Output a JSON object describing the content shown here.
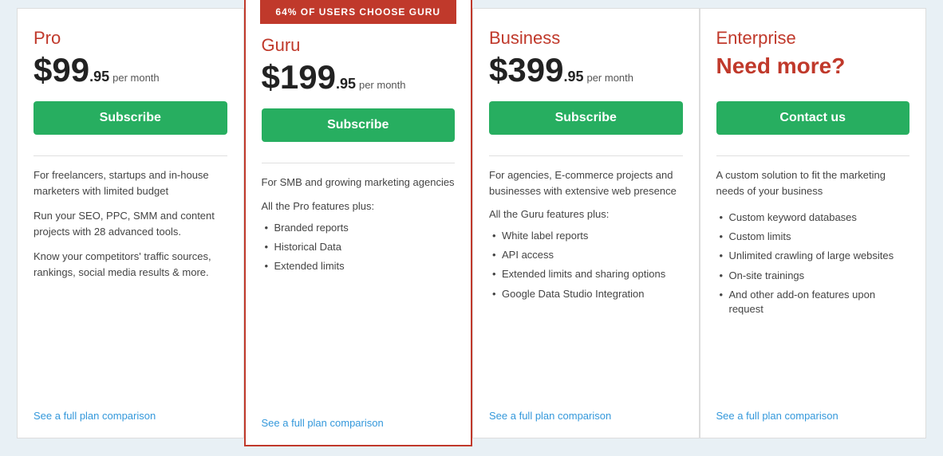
{
  "plans": [
    {
      "id": "pro",
      "name": "Pro",
      "price_main": "$99",
      "price_cents": ".95",
      "price_period": "per month",
      "button_label": "Subscribe",
      "description1": "For freelancers, startups and in-house marketers with limited budget",
      "description2": "Run your SEO, PPC, SMM and content projects with 28 advanced tools.",
      "description3": "Know your competitors' traffic sources, rankings, social media results & more.",
      "see_full_label": "See a full plan comparison",
      "featured": false,
      "featured_badge": ""
    },
    {
      "id": "guru",
      "name": "Guru",
      "price_main": "$199",
      "price_cents": ".95",
      "price_period": "per month",
      "button_label": "Subscribe",
      "description1": "For SMB and growing marketing agencies",
      "features_intro": "All the Pro features plus:",
      "features": [
        "Branded reports",
        "Historical Data",
        "Extended limits"
      ],
      "see_full_label": "See a full plan comparison",
      "featured": true,
      "featured_badge": "64% OF USERS CHOOSE GURU"
    },
    {
      "id": "business",
      "name": "Business",
      "price_main": "$399",
      "price_cents": ".95",
      "price_period": "per month",
      "button_label": "Subscribe",
      "description1": "For agencies, E-commerce projects and businesses with extensive web presence",
      "features_intro": "All the Guru features plus:",
      "features": [
        "White label reports",
        "API access",
        "Extended limits and sharing options",
        "Google Data Studio Integration"
      ],
      "see_full_label": "See a full plan comparison",
      "featured": false,
      "featured_badge": ""
    },
    {
      "id": "enterprise",
      "name": "Enterprise",
      "need_more": "Need more?",
      "button_label": "Contact us",
      "description1": "A custom solution to fit the marketing needs of your business",
      "features": [
        "Custom keyword databases",
        "Custom limits",
        "Unlimited crawling of large websites",
        "On-site trainings",
        "And other add-on features upon request"
      ],
      "see_full_label": "See a full plan comparison",
      "featured": false,
      "featured_badge": ""
    }
  ]
}
